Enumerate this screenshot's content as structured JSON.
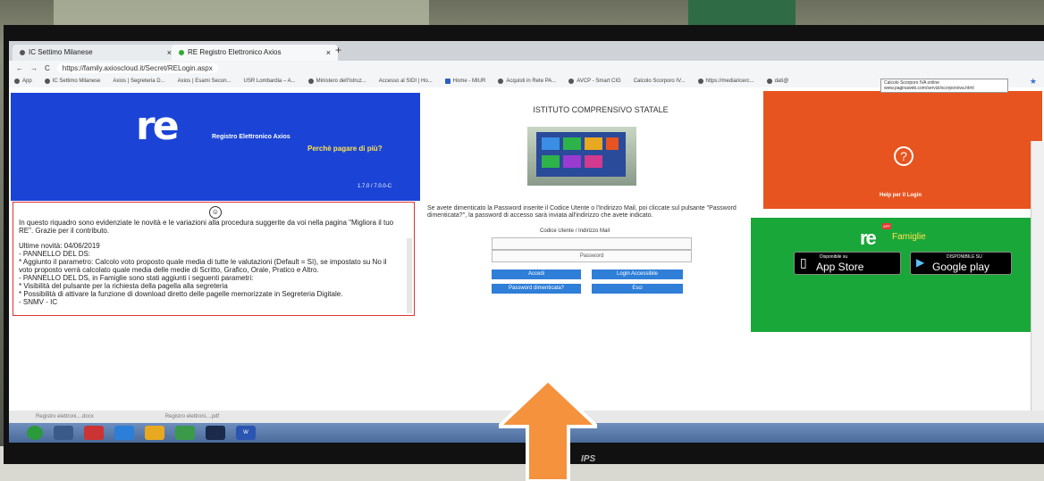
{
  "browser": {
    "tabs": [
      {
        "label": "IC Settimo Milanese",
        "close": "×",
        "active": false
      },
      {
        "label": "RE Registro Elettronico Axios",
        "close": "×",
        "active": true
      }
    ],
    "new_tab": "+",
    "url": "https://family.axioscloud.it/Secret/RELogin.aspx",
    "bookmarks": [
      "App",
      "IC Settimo Milanese",
      "Axios | Segreteria D...",
      "Axios | Esami Secon...",
      "USR Lombardia – A...",
      "Ministero dell'Istruz...",
      "Accesso al SIDI | Ho...",
      "Home - MIUR",
      "Acquisti in Rete PA...",
      "AVCP - Smart CIG",
      "Calcolo Scorporo IV...",
      "https://mediaricerc...",
      "dati@"
    ],
    "tooltip": "Calcolo Scorporo IVA online www.paginaweb.com/servizi/scorporoiva.html"
  },
  "header": {
    "logo": "re",
    "app_name": "Registro Elettronico Axios",
    "slogan": "Perchè pagare di più?",
    "version": "1.7.0 / 7.0.0-C"
  },
  "notes": {
    "bulb": "☺",
    "intro": "In questo riquadro sono evidenziate le novità e le variazioni alla procedura suggerite da voi nella pagina \"Migliora il tuo RE\". Grazie per il contributo.",
    "lines": [
      "Ultime novità: 04/06/2019",
      "- PANNELLO DEL DS:",
      "* Aggiunto il parametro: Calcolo voto proposto quale media di tutte le valutazioni (Default = Sì), se impostato su No il voto proposto verrà calcolato quale media delle medie di Scritto, Grafico, Orale, Pratico e Altro.",
      "- PANNELLO DEL DS, in Famiglie sono stati aggiunti i seguenti parametri:",
      "* Visibilità del pulsante per la richiesta della pagella alla segreteria",
      "* Possibilità di attivare la funzione di download diretto delle pagelle memorizzate in Segreteria Digitale.",
      "- SNMV - IC"
    ]
  },
  "login": {
    "institute": "ISTITUTO COMPRENSIVO STATALE",
    "forgot_text": "Se avete dimenticato la Password inserite il Codice Utente o l'Indirizzo Mail, poi cliccate sul pulsante \"Password dimenticata?\", la password di accesso sarà inviata all'indirizzo che avete indicato.",
    "user_label": "Codice Utente / Indirizzo Mail",
    "user_value": "",
    "password_placeholder": "Password",
    "btn_login": "Accedi",
    "btn_accessible": "Login Accessibile",
    "btn_forgot": "Password dimenticata?",
    "btn_exit": "Esci"
  },
  "help": {
    "icon": "?",
    "label": "Help per il Login"
  },
  "famiglie": {
    "logo": "re",
    "app_badge": "APP",
    "title": "Famiglie",
    "appstore_small": "Disponibile su",
    "appstore_big": "App Store",
    "gplay_small": "DISPONIBILE SU",
    "gplay_big": "Google play"
  },
  "downloads": [
    "Registro elettroni....docx",
    "Registro elettroni....pdf"
  ],
  "taskbar": [
    "W"
  ],
  "monitor_brand": "IPS",
  "colors": {
    "blue": "#1b44d6",
    "orange": "#e8541f",
    "green": "#1aa73a",
    "arrow": "#f5923e"
  }
}
